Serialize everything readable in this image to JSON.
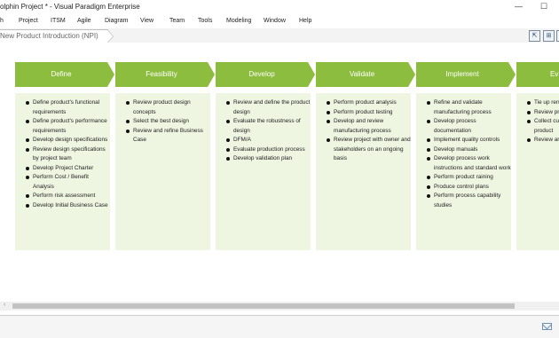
{
  "window": {
    "title": "olphin Project * - Visual Paradigm Enterprise",
    "minimize": "—",
    "maximize": "☐"
  },
  "menu": [
    "h",
    "Project",
    "ITSM",
    "Agile",
    "Diagram",
    "View",
    "Team",
    "Tools",
    "Modeling",
    "Window",
    "Help"
  ],
  "breadcrumb": "New Product Introduction (NPI)",
  "toolbar_icons": [
    "share-icon",
    "grid-icon",
    "panel-icon"
  ],
  "stages": [
    {
      "title": "Define",
      "items": [
        "Define product's functional requirements",
        "Define product's performance requirements",
        "Develop design specifications",
        "Review design specifications by project team",
        "Develop Project Charter",
        "Perform Cost / Benefit Analysis",
        "Perform risk assessment",
        "Develop Initial Business Case"
      ]
    },
    {
      "title": "Feasibility",
      "items": [
        "Review product design concepts",
        "Select the best design",
        "Review and refine Business Case"
      ]
    },
    {
      "title": "Develop",
      "items": [
        "Review and define the product design",
        "Evaluate the robustness of design",
        "DFM/A",
        "Evaluate production process",
        "Develop validation plan"
      ]
    },
    {
      "title": "Validate",
      "items": [
        "Perform product analysis",
        "Perform product testing",
        "Develop and review manufacturing process",
        "Review project with owner and stakeholders on an ongoing basis"
      ]
    },
    {
      "title": "Implement",
      "items": [
        "Refine and validate manufacturing process",
        "Develop process documentation",
        "Implement quality controls",
        "Develop manuals",
        "Develop process work instructions and standard work",
        "Perform product raining",
        "Produce control plans",
        "Perform process capability studies"
      ]
    },
    {
      "title": "Ev",
      "items": [
        "Tie up ren documen",
        "Review pr performa",
        "Collect cu feedback product",
        "Review ar any lesso"
      ]
    }
  ]
}
